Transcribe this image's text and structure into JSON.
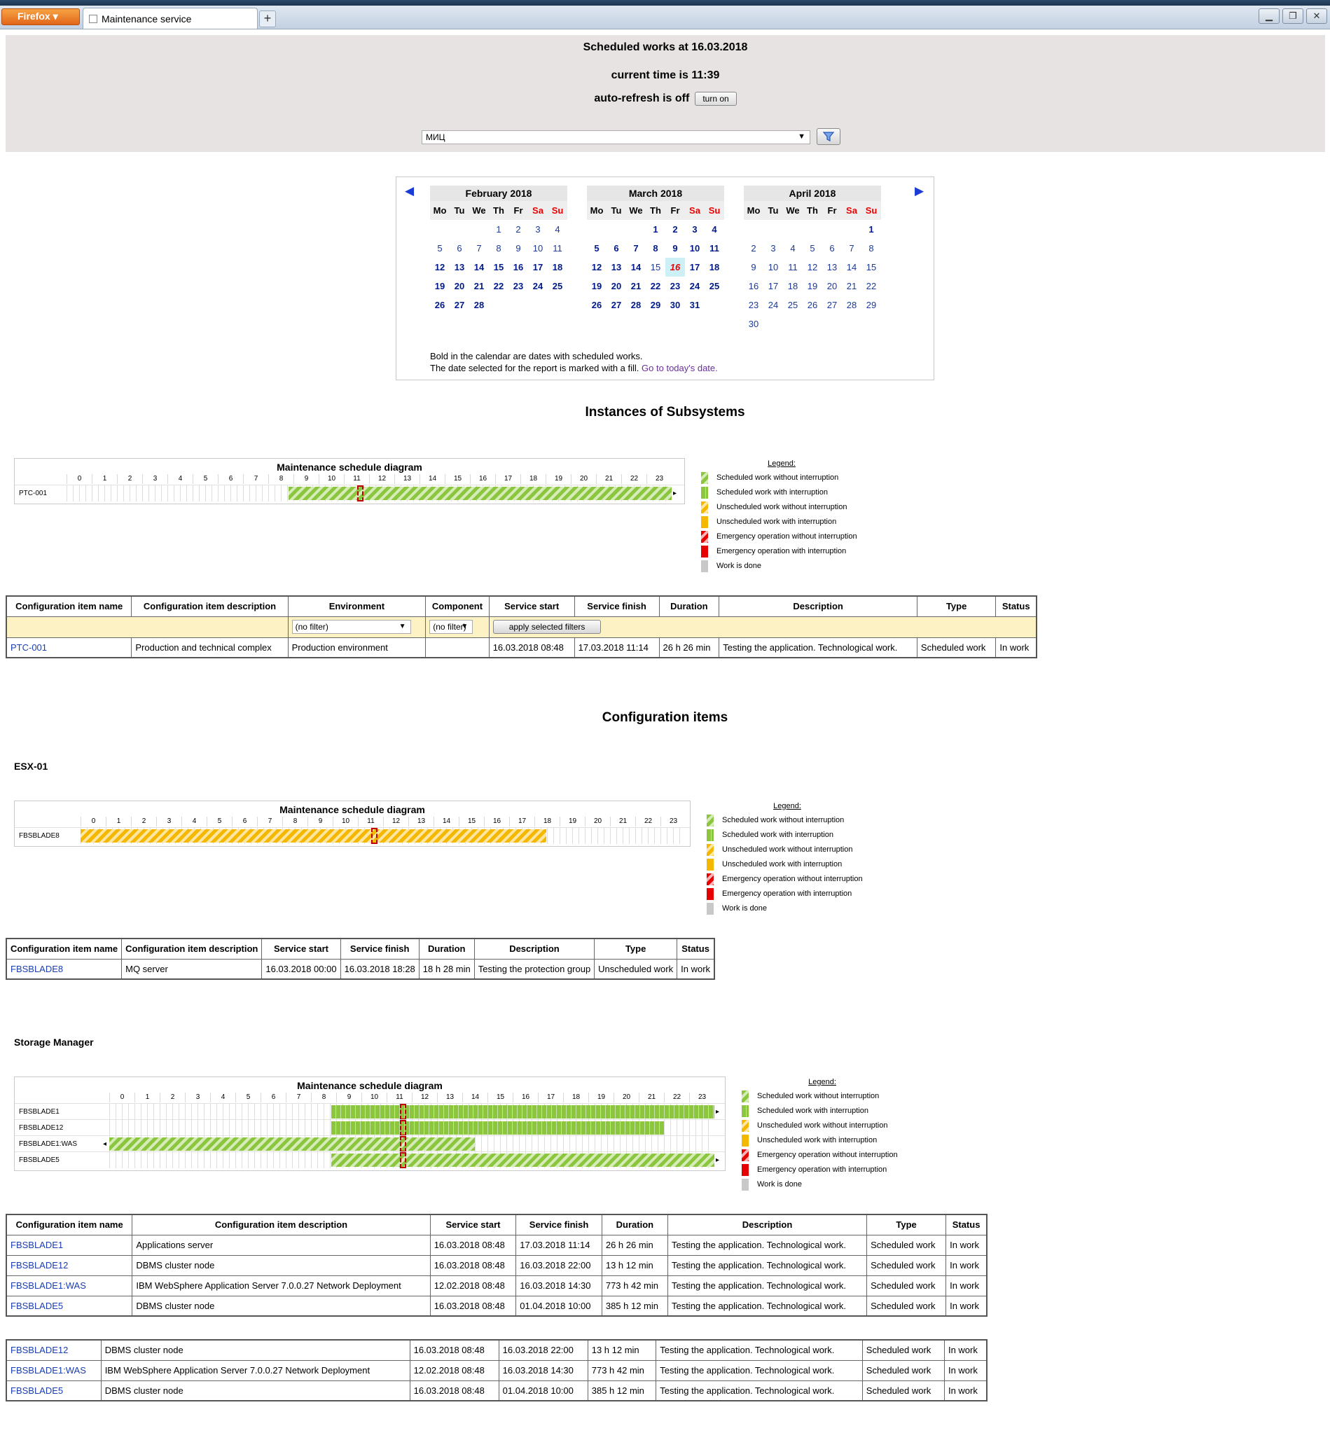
{
  "browser": {
    "menu_button": "Firefox",
    "tab_title": "Maintenance service",
    "new_tab": "+"
  },
  "header": {
    "title": "Scheduled works at 16.03.2018",
    "current_time": "current time is 11:39",
    "autorefresh": "auto-refresh is off",
    "turn_on": "turn on",
    "select_value": "МИЦ"
  },
  "calendar": {
    "weekdays": [
      "Mo",
      "Tu",
      "We",
      "Th",
      "Fr",
      "Sa",
      "Su"
    ],
    "months": [
      {
        "title": "February 2018",
        "offset": 3,
        "days": 28,
        "bold": [
          12,
          13,
          14,
          15,
          16,
          17,
          18,
          19,
          20,
          21,
          22,
          23,
          24,
          25,
          26,
          27,
          28
        ]
      },
      {
        "title": "March 2018",
        "offset": 3,
        "days": 31,
        "bold": [
          1,
          2,
          3,
          4,
          5,
          6,
          7,
          8,
          9,
          10,
          11,
          12,
          13,
          14,
          16,
          17,
          18,
          19,
          20,
          21,
          22,
          23,
          24,
          25,
          26,
          27,
          28,
          29,
          30,
          31
        ],
        "selected": 16
      },
      {
        "title": "April 2018",
        "offset": 6,
        "days": 30,
        "bold": [
          1
        ]
      }
    ],
    "note_line1": "Bold in the calendar are dates with scheduled works.",
    "note_line2": "The date selected for the report is marked with a fill.",
    "today_link": "Go to today's date."
  },
  "sections": {
    "instances": "Instances of Subsystems",
    "config_items": "Configuration items",
    "group_esx": "ESX-01",
    "group_storage": "Storage Manager"
  },
  "gantt_title": "Maintenance schedule diagram",
  "legend": {
    "title": "Legend:",
    "items": [
      {
        "label": "Scheduled work without interruption",
        "pattern": "sg"
      },
      {
        "label": "Scheduled work with interruption",
        "pattern": "si"
      },
      {
        "label": "Unscheduled work without interruption",
        "pattern": "ug"
      },
      {
        "label": "Unscheduled work with interruption",
        "pattern": "ui"
      },
      {
        "label": "Emergency operation without interruption",
        "pattern": "eg"
      },
      {
        "label": "Emergency operation with interruption",
        "pattern": "ei"
      },
      {
        "label": "Work is done",
        "pattern": "done"
      }
    ]
  },
  "colors": {
    "scheduled": "#8cc63f",
    "unscheduled": "#f5b800",
    "emergency": "#e60000",
    "done": "#c8c8c8",
    "now_marker": "#c00000"
  },
  "now_hour": 11.65,
  "gantts": [
    {
      "rows": [
        {
          "label": "PTC-001",
          "start": 8.8,
          "end": 24,
          "pattern": "sg",
          "arrow_right": true
        }
      ]
    },
    {
      "rows": [
        {
          "label": "FBSBLADE8",
          "start": 0,
          "end": 18.47,
          "pattern": "ug"
        }
      ]
    },
    {
      "rows": [
        {
          "label": "FBSBLADE1",
          "start": 8.8,
          "end": 24,
          "pattern": "si",
          "arrow_right": true
        },
        {
          "label": "FBSBLADE12",
          "start": 8.8,
          "end": 22,
          "pattern": "si"
        },
        {
          "label": "FBSBLADE1:WAS",
          "start": 0,
          "end": 14.5,
          "pattern": "sg",
          "arrow_left": true
        },
        {
          "label": "FBSBLADE5",
          "start": 8.8,
          "end": 24,
          "pattern": "sg",
          "arrow_right": true
        }
      ]
    }
  ],
  "table1": {
    "headers": [
      "Configuration item name",
      "Configuration item description",
      "Environment",
      "Component",
      "Service start",
      "Service finish",
      "Duration",
      "Description",
      "Type",
      "Status"
    ],
    "filter_env": "(no filter)",
    "filter_comp": "(no filter)",
    "apply": "apply selected filters",
    "rows": [
      [
        "PTC-001",
        "Production and technical complex",
        "Production environment",
        "",
        "16.03.2018 08:48",
        "17.03.2018 11:14",
        "26 h 26 min",
        "Testing the application. Technological work.",
        "Scheduled work",
        "In work"
      ]
    ]
  },
  "table2": {
    "headers": [
      "Configuration item name",
      "Configuration item description",
      "Service start",
      "Service finish",
      "Duration",
      "Description",
      "Type",
      "Status"
    ],
    "rows": [
      [
        "FBSBLADE8",
        "MQ server",
        "16.03.2018 00:00",
        "16.03.2018 18:28",
        "18 h 28 min",
        "Testing the protection group",
        "Unscheduled work",
        "In work"
      ]
    ]
  },
  "table3": {
    "headers": [
      "Configuration item name",
      "Configuration item description",
      "Service start",
      "Service finish",
      "Duration",
      "Description",
      "Type",
      "Status"
    ],
    "rows": [
      [
        "FBSBLADE1",
        "Applications server",
        "16.03.2018 08:48",
        "17.03.2018 11:14",
        "26 h 26 min",
        "Testing the application. Technological work.",
        "Scheduled work",
        "In work"
      ],
      [
        "FBSBLADE12",
        "DBMS cluster node",
        "16.03.2018 08:48",
        "16.03.2018 22:00",
        "13 h 12 min",
        "Testing the application. Technological work.",
        "Scheduled work",
        "In work"
      ],
      [
        "FBSBLADE1:WAS",
        "IBM WebSphere Application Server 7.0.0.27 Network Deployment",
        "12.02.2018 08:48",
        "16.03.2018 14:30",
        "773 h 42 min",
        "Testing the application. Technological work.",
        "Scheduled work",
        "In work"
      ],
      [
        "FBSBLADE5",
        "DBMS cluster node",
        "16.03.2018 08:48",
        "01.04.2018 10:00",
        "385 h 12 min",
        "Testing the application. Technological work.",
        "Scheduled work",
        "In work"
      ]
    ]
  },
  "table3_repeat": {
    "rows": [
      [
        "FBSBLADE12",
        "DBMS cluster node",
        "16.03.2018 08:48",
        "16.03.2018 22:00",
        "13 h 12 min",
        "Testing the application. Technological work.",
        "Scheduled work",
        "In work"
      ],
      [
        "FBSBLADE1:WAS",
        "IBM WebSphere Application Server 7.0.0.27 Network Deployment",
        "12.02.2018 08:48",
        "16.03.2018 14:30",
        "773 h 42 min",
        "Testing the application. Technological work.",
        "Scheduled work",
        "In work"
      ],
      [
        "FBSBLADE5",
        "DBMS cluster node",
        "16.03.2018 08:48",
        "01.04.2018 10:00",
        "385 h 12 min",
        "Testing the application. Technological work.",
        "Scheduled work",
        "In work"
      ]
    ]
  }
}
